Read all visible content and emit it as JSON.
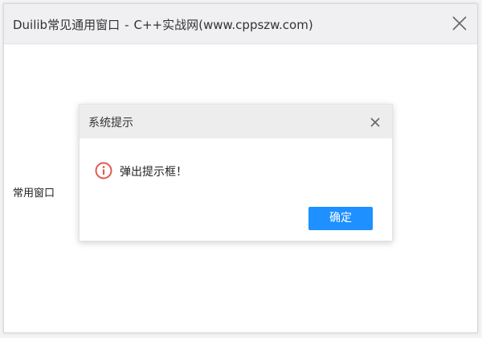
{
  "window": {
    "app_name": "Duilib常见通用窗口",
    "separator": "-",
    "subtitle": "C++实战网(www.cppszw.com)",
    "close_icon": "close-icon"
  },
  "content": {
    "label": "常用窗口"
  },
  "dialog": {
    "title": "系统提示",
    "close_icon": "close-icon",
    "message_icon": "info-circle-icon",
    "message": "弹出提示框！",
    "ok_label": "确定"
  },
  "colors": {
    "accent": "#1e90ff",
    "info_icon": "#e05a4f",
    "titlebar_bg": "#f0f0f2",
    "dialog_header_bg": "#ededed"
  }
}
